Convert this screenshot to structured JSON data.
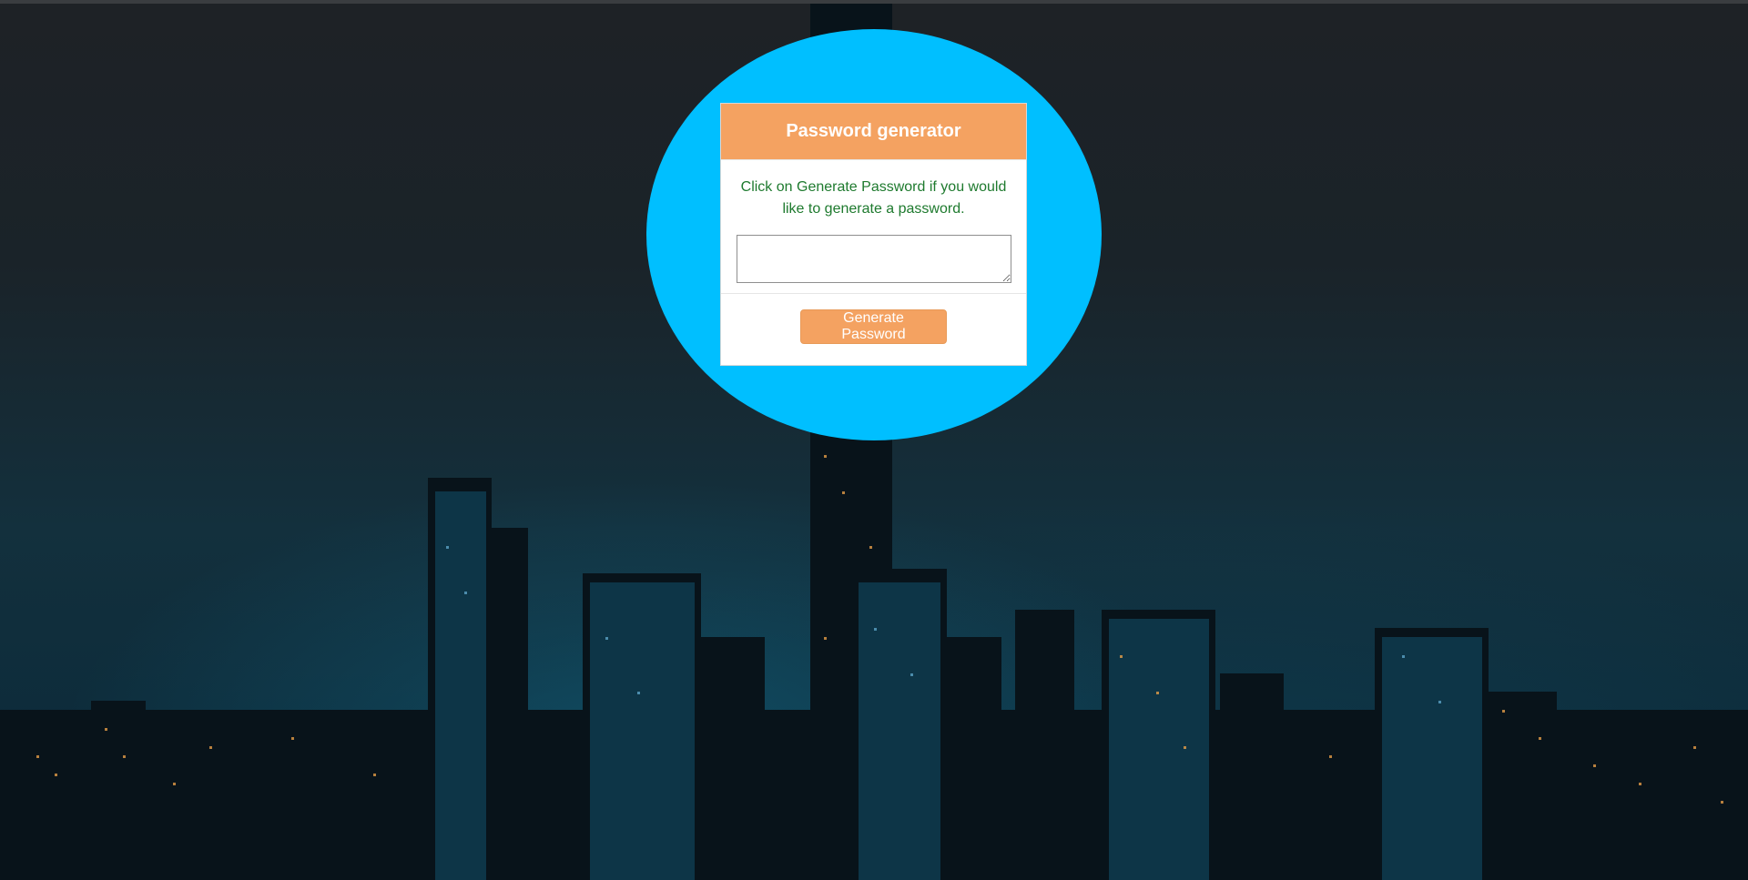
{
  "card": {
    "title": "Password generator",
    "description": "Click on Generate Password if you would like to generate a password.",
    "password_value": "",
    "generate_button_label": "Generate Password"
  },
  "colors": {
    "circle": "#00bfff",
    "header": "#f4a261",
    "button": "#f4a261",
    "description_text": "#1e7a2e"
  },
  "background": {
    "scene": "night city skyline"
  }
}
